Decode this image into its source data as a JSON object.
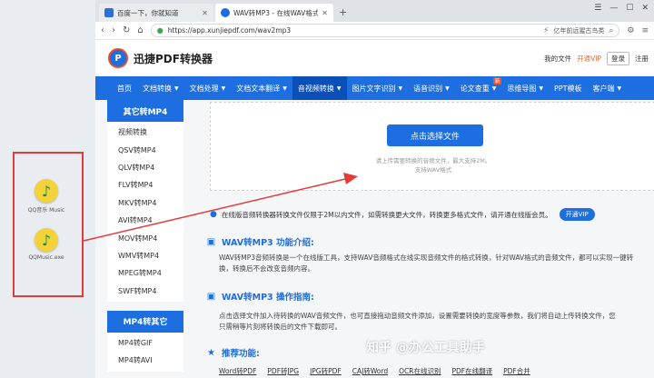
{
  "desktop": {
    "icons": [
      {
        "label": "QQ音乐 Music"
      },
      {
        "label": "QQMusic.exe"
      }
    ]
  },
  "browser": {
    "tabs": [
      {
        "label": "百度一下，你就知道",
        "color": "#2f6fdc"
      },
      {
        "label": "WAV转MP3 - 在线WAV格式转换成",
        "color": "#1d6ee0"
      }
    ],
    "new_tab": "+",
    "url": "https://app.xunjiepdf.com/wav2mp3",
    "hot_search": "亿年前远猩古鸟类"
  },
  "site": {
    "logo_text": "迅捷PDF转换器",
    "header_links": {
      "my_files": "我的文件",
      "vip": "开通VIP",
      "login": "登录",
      "register": "注册"
    },
    "nav": [
      {
        "label": "首页",
        "caret": false
      },
      {
        "label": "文档转换",
        "caret": true
      },
      {
        "label": "文档处理",
        "caret": true
      },
      {
        "label": "文档文本翻译",
        "caret": true
      },
      {
        "label": "音视频转换",
        "caret": true
      },
      {
        "label": "图片文字识别",
        "caret": true
      },
      {
        "label": "语音识别",
        "caret": true
      },
      {
        "label": "论文查重",
        "caret": true,
        "badge": "新"
      },
      {
        "label": "思维导图",
        "caret": true
      },
      {
        "label": "PPT模板",
        "caret": false
      },
      {
        "label": "客户端",
        "caret": true
      }
    ],
    "sidebar": {
      "group1_title": "其它转MP4",
      "group1_items": [
        "视频转换",
        "QSV转MP4",
        "QLV转MP4",
        "FLV转MP4",
        "MKV转MP4",
        "AVI转MP4",
        "MOV转MP4",
        "WMV转MP4",
        "MPEG转MP4",
        "SWF转MP4"
      ],
      "group2_title": "MP4转其它",
      "group2_items": [
        "MP4转GIF",
        "MP4转AVI"
      ]
    },
    "upload": {
      "button": "点击选择文件",
      "note1": "请上传需要转换的音频文件，最大支持2M。",
      "note2": "支持WAV格式"
    },
    "notice": {
      "text": "在线版音频转换器转换文件仅限于2M以内文件，如需转换更大文件，转换更多格式文件，请开通在线版会员。",
      "button": "开通VIP"
    },
    "intro": {
      "title": "WAV转MP3 功能介绍:",
      "line1": "WAV转MP3音频转换是一个在线版工具，支持WAV音频格式在线实现音频文件的格式转换，针对WAV格式的音频文件，都可以实现一键转",
      "line2": "换，转换后不会改变音频内容。"
    },
    "guide": {
      "title": "WAV转MP3 操作指南:",
      "line1": "点击选择文件加入待转换的WAV音频文件，也可直接拖动音频文件添加，设置需要转换的宽度等参数，我们将自动上传转换文件，您",
      "line2": "只需稍等片刻将转换后的文件下载即可。"
    },
    "recommend": {
      "title": "推荐功能:",
      "links": [
        "Word转PDF",
        "PDF转JPG",
        "JPG转PDF",
        "CAJ转Word",
        "OCR在线识别",
        "PDF在线翻译",
        "PDF合并"
      ]
    }
  },
  "watermark": "知乎 @办公工具助手",
  "colors": {
    "brand": "#1d6ee0",
    "annotation": "#e23b3b"
  }
}
